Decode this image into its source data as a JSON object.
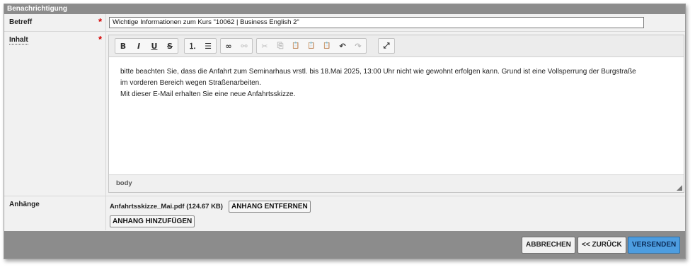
{
  "window": {
    "title": "Benachrichtigung"
  },
  "form": {
    "subject": {
      "label": "Betreff",
      "required_mark": "*",
      "value": "Wichtige Informationen zum Kurs \"10062 | Business English 2\""
    },
    "content": {
      "label": "Inhalt",
      "required_mark": "*",
      "toolbar": [
        {
          "name": "bold",
          "glyph": "B"
        },
        {
          "name": "italic",
          "glyph": "I"
        },
        {
          "name": "underline",
          "glyph": "U"
        },
        {
          "name": "strikethrough",
          "glyph": "S"
        },
        {
          "name": "numbered-list",
          "glyph": "⒈"
        },
        {
          "name": "bulleted-list",
          "glyph": "☰"
        },
        {
          "name": "link",
          "glyph": "∞"
        },
        {
          "name": "unlink",
          "glyph": "⚯"
        },
        {
          "name": "cut",
          "glyph": "✂"
        },
        {
          "name": "copy",
          "glyph": "⎘"
        },
        {
          "name": "paste",
          "glyph": "📋"
        },
        {
          "name": "paste-text",
          "glyph": "📋"
        },
        {
          "name": "paste-word",
          "glyph": "📋"
        },
        {
          "name": "undo",
          "glyph": "↶"
        },
        {
          "name": "redo",
          "glyph": "↷"
        },
        {
          "name": "maximize",
          "glyph": "⤢"
        }
      ],
      "body_lines": [
        "bitte beachten Sie, dass die Anfahrt zum Seminarhaus vrstl. bis 18.Mai 2025, 13:00 Uhr nicht wie gewohnt erfolgen kann. Grund ist eine Vollsperrung der Burgstraße",
        "im vorderen Bereich wegen Straßenarbeiten.",
        "Mit dieser E-Mail erhalten Sie eine neue Anfahrtsskizze."
      ],
      "status_path": "body"
    },
    "attachments": {
      "label": "Anhänge",
      "file": "Anfahrtsskizze_Mai.pdf (124.67 KB)",
      "remove_label": "ANHANG ENTFERNEN",
      "add_label": "ANHANG HINZUFÜGEN"
    }
  },
  "footer": {
    "cancel_label": "ABBRECHEN",
    "back_label": "<< ZURÜCK",
    "send_label": "VERSENDEN"
  }
}
